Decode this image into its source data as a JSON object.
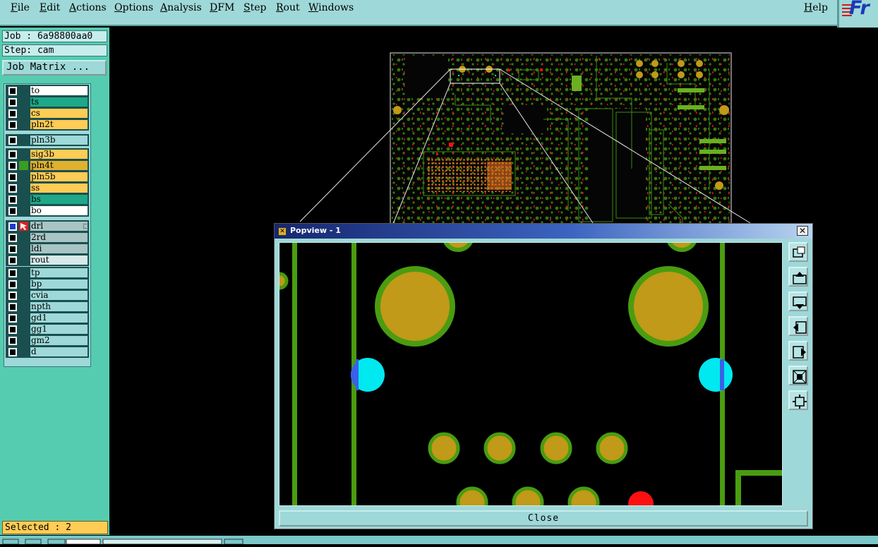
{
  "menubar": {
    "items": [
      {
        "label": "File",
        "u": "F",
        "rest": "ile"
      },
      {
        "label": "Edit",
        "u": "E",
        "rest": "dit"
      },
      {
        "label": "Actions",
        "u": "A",
        "rest": "ctions"
      },
      {
        "label": "Options",
        "u": "O",
        "rest": "ptions"
      },
      {
        "label": "Analysis",
        "u": "A",
        "rest": "nalysis"
      },
      {
        "label": "DFM",
        "u": "D",
        "rest": "FM"
      },
      {
        "label": "Step",
        "u": "S",
        "rest": "tep"
      },
      {
        "label": "Rout",
        "u": "R",
        "rest": "out"
      },
      {
        "label": "Windows",
        "u": "W",
        "rest": "indows"
      }
    ],
    "help": {
      "u": "H",
      "rest": "elp"
    },
    "logo_text": "Fr"
  },
  "job": {
    "label": "Job : 6a98800aa0",
    "step": "Step: cam"
  },
  "job_matrix_button": "Job Matrix ...",
  "layer_groups": [
    [
      {
        "name": "to",
        "color": "#ffffff"
      },
      {
        "name": "ts",
        "color": "#1ea888"
      },
      {
        "name": "cs",
        "color": "#ffcc55"
      },
      {
        "name": "pln2t",
        "color": "#ffcc55"
      }
    ],
    [
      {
        "name": "pln3b",
        "color": "#9fd8d8"
      }
    ],
    [
      {
        "name": "sig3b",
        "color": "#ffcc55"
      },
      {
        "name": "pln4t",
        "color": "#e0b030",
        "mark": "green"
      },
      {
        "name": "pln5b",
        "color": "#ffcc55"
      },
      {
        "name": "ss",
        "color": "#ffcc55"
      },
      {
        "name": "bs",
        "color": "#1ea888"
      },
      {
        "name": "bo",
        "color": "#ffffff"
      }
    ],
    [
      {
        "name": "drl",
        "color": "#a8c4c4",
        "checked": true,
        "mark": "cursor"
      },
      {
        "name": "2rd",
        "color": "#a8c4c4"
      },
      {
        "name": "ldi",
        "color": "#a8c4c4"
      },
      {
        "name": "rout",
        "color": "#d8e8e8"
      }
    ],
    [
      {
        "name": "tp",
        "color": "#9fd8d8"
      },
      {
        "name": "bp",
        "color": "#9fd8d8"
      },
      {
        "name": "cvia",
        "color": "#9fd8d8"
      },
      {
        "name": "npth",
        "color": "#9fd8d8"
      },
      {
        "name": "gd1",
        "color": "#9fd8d8"
      },
      {
        "name": "gg1",
        "color": "#9fd8d8"
      },
      {
        "name": "gm2",
        "color": "#9fd8d8"
      },
      {
        "name": "d",
        "color": "#9fd8d8"
      }
    ]
  ],
  "status": {
    "selected": "Selected : 2"
  },
  "popview": {
    "title": "Popview - 1",
    "close_label": "Close",
    "tool_icons": [
      "zoom-window-icon",
      "pan-up-icon",
      "pan-down-icon",
      "pan-left-icon",
      "pan-right-icon",
      "zoom-fit-icon",
      "center-icon"
    ]
  },
  "colors": {
    "panel": "#9fd8d8",
    "panel_dark": "#55ccb0",
    "pad_fill": "#c09a18",
    "pad_ring": "#4a9c10",
    "trace": "#4a9c10",
    "drill": "#00e8f0",
    "red_pad": "#ff1010"
  }
}
